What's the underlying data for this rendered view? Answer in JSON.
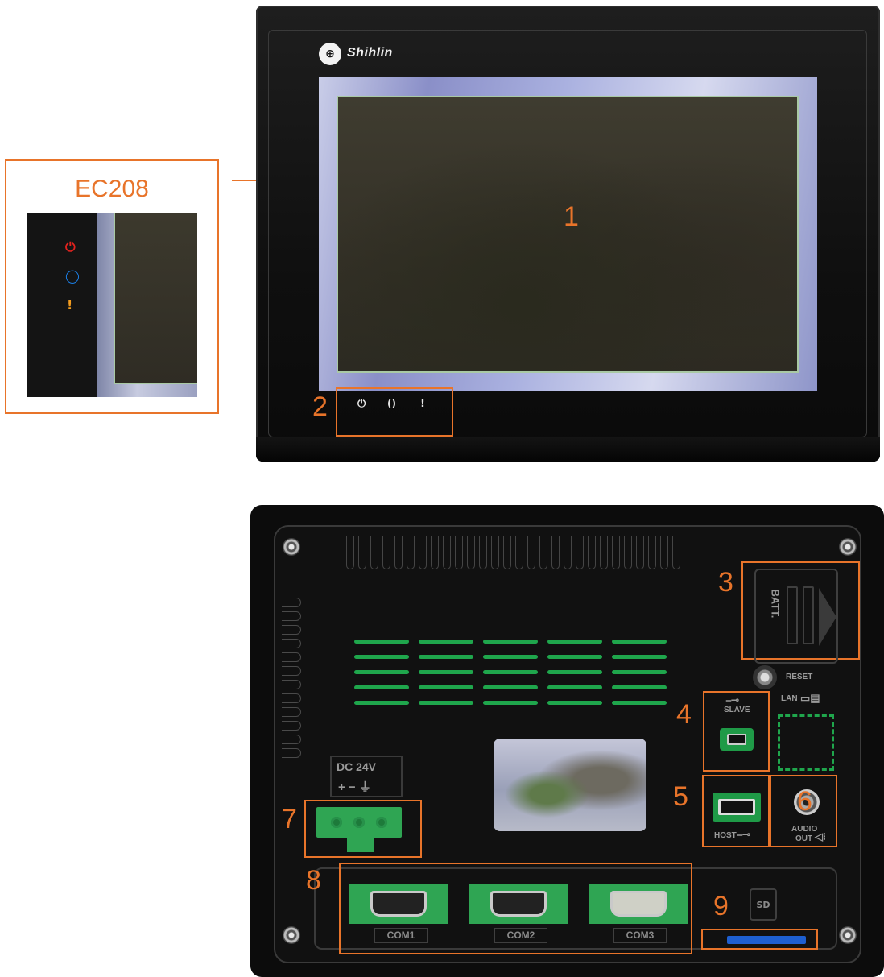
{
  "inset": {
    "title": "EC208"
  },
  "front": {
    "brand": "Shihlin",
    "screen_number": "1"
  },
  "callouts": [
    "1",
    "2",
    "3",
    "4",
    "5",
    "6",
    "7",
    "8",
    "9"
  ],
  "rear": {
    "battery_label": "BATT.",
    "reset_label": "RESET",
    "lan_label": "LAN",
    "usb_slave_label": "SLAVE",
    "usb_host_label": "HOST",
    "audio_label_line1": "AUDIO",
    "audio_label_line2": "OUT",
    "dc_label": "DC  24V",
    "dc_polarity": "+ − ⏚",
    "com_ports": [
      "COM1",
      "COM2",
      "COM3"
    ],
    "sd_label": "SD"
  },
  "colors": {
    "callout_orange": "#e8742a",
    "connector_green": "#2fa553",
    "sd_blue": "#1e5fd0",
    "led_power": "#e0221e",
    "led_comm": "#1b7fe6",
    "led_alarm": "#f29c1f"
  },
  "icons": {
    "power_led": "power-icon",
    "comm_led": "sync-icon",
    "alarm_led": "exclamation-icon"
  }
}
